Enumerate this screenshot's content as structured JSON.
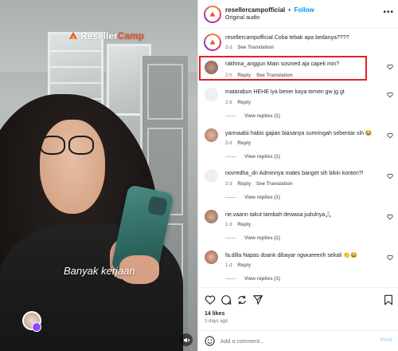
{
  "video": {
    "brand_prefix": "Reseller",
    "brand_suffix": "Camp",
    "caption": "Banyak kerjaan"
  },
  "header": {
    "username": "resellercampofficial",
    "separator": "•",
    "follow_label": "Follow",
    "audio": "Original audio",
    "more": "•••"
  },
  "comments": [
    {
      "user": "resellercampofficial",
      "text": "Coba tebak apa bedanya????",
      "time": "3 d",
      "actions": [
        "See Translation"
      ],
      "replies": ""
    },
    {
      "user": "rakhma_anggun",
      "text": "Main sosmed aja capek min?",
      "time": "2 h",
      "actions": [
        "Reply",
        "See Translation"
      ],
      "replies": ""
    },
    {
      "user": "matarabun",
      "text": "HEHE iya bener kaya temen gw jg gt",
      "time": "3 d",
      "actions": [
        "Reply"
      ],
      "replies": "View replies (1)"
    },
    {
      "user": "yannaabii",
      "text": "habis gajian biasanya sumringah sebentar sih 😂",
      "time": "3 d",
      "actions": [
        "Reply"
      ],
      "replies": "View replies (1)"
    },
    {
      "user": "novredha_dn",
      "text": "Adminnya males banget sih bikin konten?!",
      "time": "3 d",
      "actions": [
        "Reply",
        "See Translation"
      ],
      "replies": "View replies (1)"
    },
    {
      "user": "rie.vaann",
      "text": "takut tambah dewasa judulnya🙏🏻",
      "time": "1 d",
      "actions": [
        "Reply"
      ],
      "replies": "View replies (1)"
    },
    {
      "user": "fa.dilla",
      "text": "Napas doank dibayar ngwueeerih sekali 👏😂",
      "time": "1 d",
      "actions": [
        "Reply"
      ],
      "replies": "View replies (1)"
    }
  ],
  "actions": {
    "likes": "14 likes",
    "posted": "3 days ago",
    "icons": [
      "heart-icon",
      "comment-icon",
      "share-icon",
      "send-icon",
      "bookmark-icon"
    ]
  },
  "add_comment": {
    "placeholder": "Add a comment...",
    "post_label": "Post"
  },
  "colors": {
    "accent": "#0095f6",
    "highlight": "#e02424",
    "brand_orange": "#e8532a"
  }
}
